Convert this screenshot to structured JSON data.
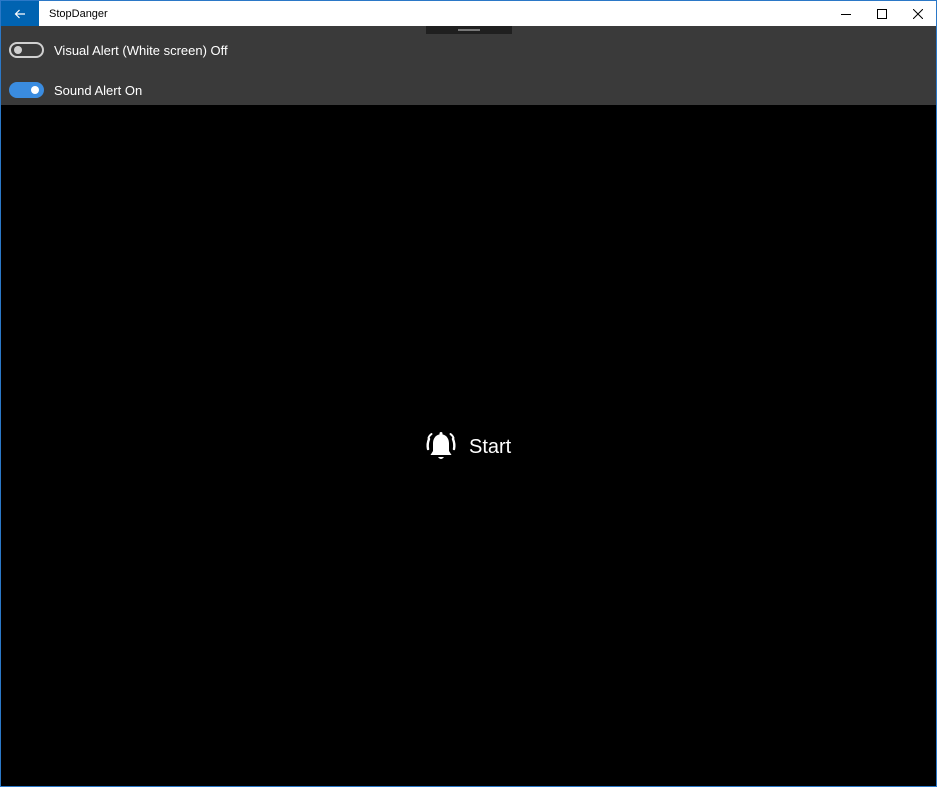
{
  "window": {
    "title": "StopDanger"
  },
  "icons": {
    "back": "back-arrow-icon",
    "minimize": "minimize-icon",
    "maximize": "maximize-icon",
    "close": "close-icon",
    "start": "alarm-bell-icon"
  },
  "settings": {
    "visual_alert": {
      "label": "Visual Alert (White screen) Off",
      "state": "off"
    },
    "sound_alert": {
      "label": "Sound Alert On",
      "state": "on"
    }
  },
  "main": {
    "start_label": "Start"
  },
  "colors": {
    "accent": "#0063b1",
    "toggle_on": "#3a8ce0",
    "panel_bg": "#3a3a3a",
    "content_bg": "#000000"
  }
}
